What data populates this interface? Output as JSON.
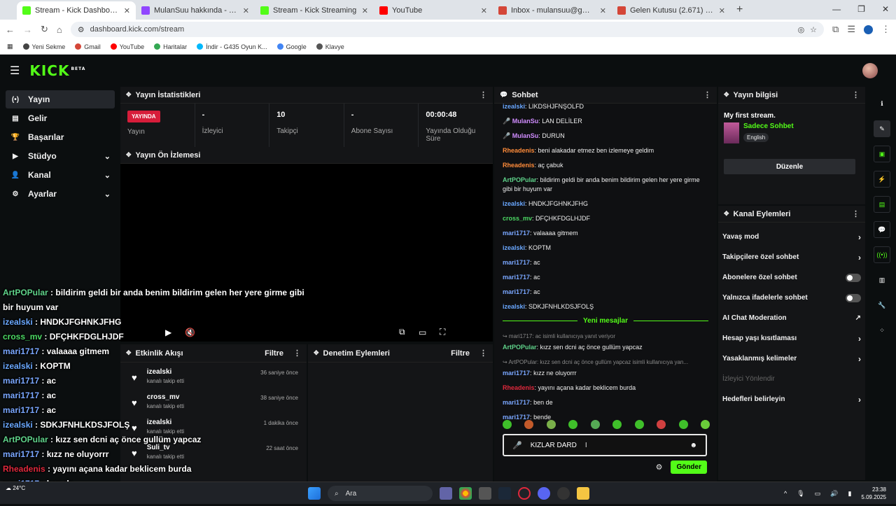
{
  "browser": {
    "tabs": [
      {
        "label": "Stream - Kick Dashboard",
        "color": "#53fc18",
        "active": true
      },
      {
        "label": "MulanSuu hakkında - Twitch",
        "color": "#9146ff",
        "active": false
      },
      {
        "label": "Stream - Kick Streaming",
        "color": "#53fc18",
        "active": false
      },
      {
        "label": "YouTube",
        "color": "#ff0000",
        "active": false
      },
      {
        "label": "Inbox - mulansuu@gmail.com -",
        "color": "#d44638",
        "active": false
      },
      {
        "label": "Gelen Kutusu (2.671) - iremolm",
        "color": "#d44638",
        "active": false
      }
    ],
    "url": "dashboard.kick.com/stream",
    "bookmarks": [
      {
        "label": "Yeni Sekme",
        "color": "#444"
      },
      {
        "label": "Gmail",
        "color": "#d44638"
      },
      {
        "label": "YouTube",
        "color": "#ff0000"
      },
      {
        "label": "Haritalar",
        "color": "#34a853"
      },
      {
        "label": "İndir - G435 Oyun K...",
        "color": "#00b8fc"
      },
      {
        "label": "Google",
        "color": "#4285f4"
      },
      {
        "label": "Klavye",
        "color": "#555"
      }
    ]
  },
  "nav": [
    {
      "label": "Yayın",
      "icon": "(•)",
      "chev": false,
      "active": true
    },
    {
      "label": "Gelir",
      "icon": "▤",
      "chev": false,
      "active": false
    },
    {
      "label": "Başarılar",
      "icon": "🏆",
      "chev": false,
      "active": false
    },
    {
      "label": "Stüdyo",
      "icon": "▶",
      "chev": true,
      "active": false
    },
    {
      "label": "Kanal",
      "icon": "👤",
      "chev": true,
      "active": false
    },
    {
      "label": "Ayarlar",
      "icon": "⚙",
      "chev": true,
      "active": false
    }
  ],
  "stats": {
    "title": "Yayın İstatistikleri",
    "live_badge": "YAYINDA",
    "items": [
      {
        "value": "",
        "label": "Yayın"
      },
      {
        "value": "-",
        "label": "İzleyici"
      },
      {
        "value": "10",
        "label": "Takipçi"
      },
      {
        "value": "-",
        "label": "Abone Sayısı"
      },
      {
        "value": "00:00:48",
        "label": "Yayında Olduğu Süre"
      }
    ]
  },
  "preview": {
    "title": "Yayın Ön İzlemesi"
  },
  "events": {
    "title": "Etkinlik Akışı",
    "filter": "Filtre",
    "items": [
      {
        "name": "izealski",
        "sub": "kanalı takip etti",
        "time": "36 saniye önce"
      },
      {
        "name": "cross_mv",
        "sub": "kanalı takip etti",
        "time": "38 saniye önce"
      },
      {
        "name": "izealski",
        "sub": "kanalı takip etti",
        "time": "1 dakika önce"
      },
      {
        "name": "Suli_tv",
        "sub": "kanalı takip etti",
        "time": "22 saat önce"
      }
    ]
  },
  "mod": {
    "title": "Denetim Eylemleri",
    "filter": "Filtre"
  },
  "chat": {
    "title": "Sohbet",
    "messages": [
      {
        "user": "izealski",
        "color": "#6aa8ff",
        "text": "LIKDSHJFNŞOLFD",
        "mic": false
      },
      {
        "user": "MulanSu",
        "color": "#d08cff",
        "text": "LAN DELİLER",
        "mic": true
      },
      {
        "user": "MulanSu",
        "color": "#d08cff",
        "text": "DURUN",
        "mic": true
      },
      {
        "user": "Rheadenis",
        "color": "#ff8c3a",
        "text": "beni alakadar etmez ben izlemeye geldim",
        "mic": false
      },
      {
        "user": "Rheadenis",
        "color": "#ff8c3a",
        "text": "aç çabuk",
        "mic": false
      },
      {
        "user": "ArtPOPular",
        "color": "#5fd38a",
        "text": "bildirim geldi bir anda benim bildirim gelen her yere girme gibi bir huyum var",
        "mic": false
      },
      {
        "user": "izealski",
        "color": "#6aa8ff",
        "text": "HNDKJFGHNKJFHG",
        "mic": false
      },
      {
        "user": "cross_mv",
        "color": "#4cd964",
        "text": "DFÇHKFDGLHJDF",
        "mic": false
      },
      {
        "user": "mari1717",
        "color": "#7aa7ff",
        "text": "valaaaa gitmem",
        "mic": false
      },
      {
        "user": "izealski",
        "color": "#6aa8ff",
        "text": "KOPTM",
        "mic": false
      },
      {
        "user": "mari1717",
        "color": "#7aa7ff",
        "text": "ac",
        "mic": false
      },
      {
        "user": "mari1717",
        "color": "#7aa7ff",
        "text": "ac",
        "mic": false
      },
      {
        "user": "mari1717",
        "color": "#7aa7ff",
        "text": "ac",
        "mic": false
      },
      {
        "user": "izealski",
        "color": "#6aa8ff",
        "text": "SDKJFNHLKDSJFOLŞ",
        "mic": false
      }
    ],
    "new_messages_label": "Yeni mesajlar",
    "new_messages": [
      {
        "reply": "↪ mari1717: ac isimli kullanıcıya yanıt veriyor",
        "user": "ArtPOPular",
        "color": "#5fd38a",
        "text": "kızz sen dcni aç önce gullüm yapcaz"
      },
      {
        "reply": "↪ ArtPOPular: kızz sen dcni aç önce gullüm yapcaz isimli kullanıcıya yan...",
        "user": "mari1717",
        "color": "#7aa7ff",
        "text": "kızz ne oluyorrr"
      },
      {
        "reply": "",
        "user": "Rheadenis",
        "color": "#e0283c",
        "text": "yayını açana kadar beklicem burda"
      },
      {
        "reply": "",
        "user": "mari1717",
        "color": "#7aa7ff",
        "text": "ben de"
      },
      {
        "reply": "",
        "user": "mari1717",
        "color": "#7aa7ff",
        "text": "bende"
      }
    ],
    "input_value": "KIZLAR DARD",
    "send_label": "Gönder"
  },
  "stream_info": {
    "title": "Yayın bilgisi",
    "stream_title": "My first stream.",
    "category": "Sadece Sohbet",
    "language": "English",
    "edit_label": "Düzenle"
  },
  "channel_actions": {
    "title": "Kanal Eylemleri",
    "rows": [
      {
        "label": "Yavaş mod",
        "kind": "chev",
        "dim": false
      },
      {
        "label": "Takipçilere özel sohbet",
        "kind": "chev",
        "dim": false
      },
      {
        "label": "Abonelere özel sohbet",
        "kind": "toggle",
        "dim": false
      },
      {
        "label": "Yalnızca ifadelerle sohbet",
        "kind": "toggle",
        "dim": false
      },
      {
        "label": "AI Chat Moderation",
        "kind": "ext",
        "dim": false
      },
      {
        "label": "Hesap yaşı kısıtlaması",
        "kind": "chev",
        "dim": false
      },
      {
        "label": "Yasaklanmış kelimeler",
        "kind": "chev",
        "dim": false
      },
      {
        "label": "İzleyici Yönlendir",
        "kind": "none",
        "dim": true
      },
      {
        "label": "Hedefleri belirleyin",
        "kind": "chev",
        "dim": false
      }
    ]
  },
  "overlay": [
    {
      "user": "ArtPOPular",
      "color": "#5fd38a",
      "text": "bildirim geldi bir anda benim bildirim gelen her yere girme gibi"
    },
    {
      "user": "",
      "color": "#ffffff",
      "text": "bir huyum var"
    },
    {
      "user": "izealski",
      "color": "#6aa8ff",
      "text": "HNDKJFGHNKJFHG"
    },
    {
      "user": "cross_mv",
      "color": "#4cd964",
      "text": "DFÇHKFDGLHJDF"
    },
    {
      "user": "mari1717",
      "color": "#7aa7ff",
      "text": "valaaaa gitmem"
    },
    {
      "user": "izealski",
      "color": "#6aa8ff",
      "text": "KOPTM"
    },
    {
      "user": "mari1717",
      "color": "#7aa7ff",
      "text": "ac"
    },
    {
      "user": "mari1717",
      "color": "#7aa7ff",
      "text": "ac"
    },
    {
      "user": "mari1717",
      "color": "#7aa7ff",
      "text": "ac"
    },
    {
      "user": "izealski",
      "color": "#6aa8ff",
      "text": "SDKJFNHLKDSJFOLŞ"
    },
    {
      "user": "ArtPOPular",
      "color": "#5fd38a",
      "text": "kızz sen dcni aç önce gullüm yapcaz"
    },
    {
      "user": "mari1717",
      "color": "#7aa7ff",
      "text": "kızz ne oluyorrr"
    },
    {
      "user": "Rheadenis",
      "color": "#e0283c",
      "text": "yayını açana kadar beklicem burda"
    },
    {
      "user": "mari1717",
      "color": "#7aa7ff",
      "text": "ben de"
    },
    {
      "user": "mari1717",
      "color": "#7aa7ff",
      "text": "bende"
    }
  ],
  "taskbar": {
    "search": "Ara",
    "temp": "24°C",
    "time": "23:38",
    "date": "5.09.2025"
  },
  "colors": {
    "kick_green": "#53fc18",
    "live_red": "#d71d3a",
    "panel": "#141517"
  }
}
